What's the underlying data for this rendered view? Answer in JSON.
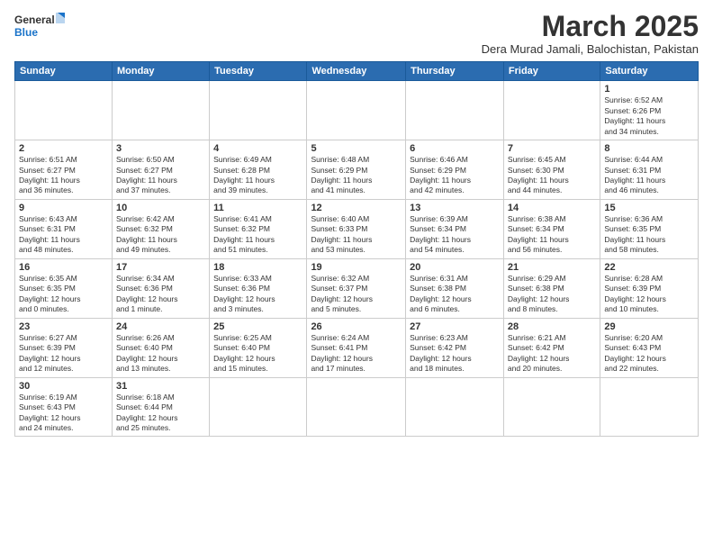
{
  "logo": {
    "text_general": "General",
    "text_blue": "Blue"
  },
  "title": {
    "month_year": "March 2025",
    "location": "Dera Murad Jamali, Balochistan, Pakistan"
  },
  "weekdays": [
    "Sunday",
    "Monday",
    "Tuesday",
    "Wednesday",
    "Thursday",
    "Friday",
    "Saturday"
  ],
  "weeks": [
    [
      {
        "day": "",
        "info": ""
      },
      {
        "day": "",
        "info": ""
      },
      {
        "day": "",
        "info": ""
      },
      {
        "day": "",
        "info": ""
      },
      {
        "day": "",
        "info": ""
      },
      {
        "day": "",
        "info": ""
      },
      {
        "day": "1",
        "info": "Sunrise: 6:52 AM\nSunset: 6:26 PM\nDaylight: 11 hours\nand 34 minutes."
      }
    ],
    [
      {
        "day": "2",
        "info": "Sunrise: 6:51 AM\nSunset: 6:27 PM\nDaylight: 11 hours\nand 36 minutes."
      },
      {
        "day": "3",
        "info": "Sunrise: 6:50 AM\nSunset: 6:27 PM\nDaylight: 11 hours\nand 37 minutes."
      },
      {
        "day": "4",
        "info": "Sunrise: 6:49 AM\nSunset: 6:28 PM\nDaylight: 11 hours\nand 39 minutes."
      },
      {
        "day": "5",
        "info": "Sunrise: 6:48 AM\nSunset: 6:29 PM\nDaylight: 11 hours\nand 41 minutes."
      },
      {
        "day": "6",
        "info": "Sunrise: 6:46 AM\nSunset: 6:29 PM\nDaylight: 11 hours\nand 42 minutes."
      },
      {
        "day": "7",
        "info": "Sunrise: 6:45 AM\nSunset: 6:30 PM\nDaylight: 11 hours\nand 44 minutes."
      },
      {
        "day": "8",
        "info": "Sunrise: 6:44 AM\nSunset: 6:31 PM\nDaylight: 11 hours\nand 46 minutes."
      }
    ],
    [
      {
        "day": "9",
        "info": "Sunrise: 6:43 AM\nSunset: 6:31 PM\nDaylight: 11 hours\nand 48 minutes."
      },
      {
        "day": "10",
        "info": "Sunrise: 6:42 AM\nSunset: 6:32 PM\nDaylight: 11 hours\nand 49 minutes."
      },
      {
        "day": "11",
        "info": "Sunrise: 6:41 AM\nSunset: 6:32 PM\nDaylight: 11 hours\nand 51 minutes."
      },
      {
        "day": "12",
        "info": "Sunrise: 6:40 AM\nSunset: 6:33 PM\nDaylight: 11 hours\nand 53 minutes."
      },
      {
        "day": "13",
        "info": "Sunrise: 6:39 AM\nSunset: 6:34 PM\nDaylight: 11 hours\nand 54 minutes."
      },
      {
        "day": "14",
        "info": "Sunrise: 6:38 AM\nSunset: 6:34 PM\nDaylight: 11 hours\nand 56 minutes."
      },
      {
        "day": "15",
        "info": "Sunrise: 6:36 AM\nSunset: 6:35 PM\nDaylight: 11 hours\nand 58 minutes."
      }
    ],
    [
      {
        "day": "16",
        "info": "Sunrise: 6:35 AM\nSunset: 6:35 PM\nDaylight: 12 hours\nand 0 minutes."
      },
      {
        "day": "17",
        "info": "Sunrise: 6:34 AM\nSunset: 6:36 PM\nDaylight: 12 hours\nand 1 minute."
      },
      {
        "day": "18",
        "info": "Sunrise: 6:33 AM\nSunset: 6:36 PM\nDaylight: 12 hours\nand 3 minutes."
      },
      {
        "day": "19",
        "info": "Sunrise: 6:32 AM\nSunset: 6:37 PM\nDaylight: 12 hours\nand 5 minutes."
      },
      {
        "day": "20",
        "info": "Sunrise: 6:31 AM\nSunset: 6:38 PM\nDaylight: 12 hours\nand 6 minutes."
      },
      {
        "day": "21",
        "info": "Sunrise: 6:29 AM\nSunset: 6:38 PM\nDaylight: 12 hours\nand 8 minutes."
      },
      {
        "day": "22",
        "info": "Sunrise: 6:28 AM\nSunset: 6:39 PM\nDaylight: 12 hours\nand 10 minutes."
      }
    ],
    [
      {
        "day": "23",
        "info": "Sunrise: 6:27 AM\nSunset: 6:39 PM\nDaylight: 12 hours\nand 12 minutes."
      },
      {
        "day": "24",
        "info": "Sunrise: 6:26 AM\nSunset: 6:40 PM\nDaylight: 12 hours\nand 13 minutes."
      },
      {
        "day": "25",
        "info": "Sunrise: 6:25 AM\nSunset: 6:40 PM\nDaylight: 12 hours\nand 15 minutes."
      },
      {
        "day": "26",
        "info": "Sunrise: 6:24 AM\nSunset: 6:41 PM\nDaylight: 12 hours\nand 17 minutes."
      },
      {
        "day": "27",
        "info": "Sunrise: 6:23 AM\nSunset: 6:42 PM\nDaylight: 12 hours\nand 18 minutes."
      },
      {
        "day": "28",
        "info": "Sunrise: 6:21 AM\nSunset: 6:42 PM\nDaylight: 12 hours\nand 20 minutes."
      },
      {
        "day": "29",
        "info": "Sunrise: 6:20 AM\nSunset: 6:43 PM\nDaylight: 12 hours\nand 22 minutes."
      }
    ],
    [
      {
        "day": "30",
        "info": "Sunrise: 6:19 AM\nSunset: 6:43 PM\nDaylight: 12 hours\nand 24 minutes."
      },
      {
        "day": "31",
        "info": "Sunrise: 6:18 AM\nSunset: 6:44 PM\nDaylight: 12 hours\nand 25 minutes."
      },
      {
        "day": "",
        "info": ""
      },
      {
        "day": "",
        "info": ""
      },
      {
        "day": "",
        "info": ""
      },
      {
        "day": "",
        "info": ""
      },
      {
        "day": "",
        "info": ""
      }
    ]
  ]
}
